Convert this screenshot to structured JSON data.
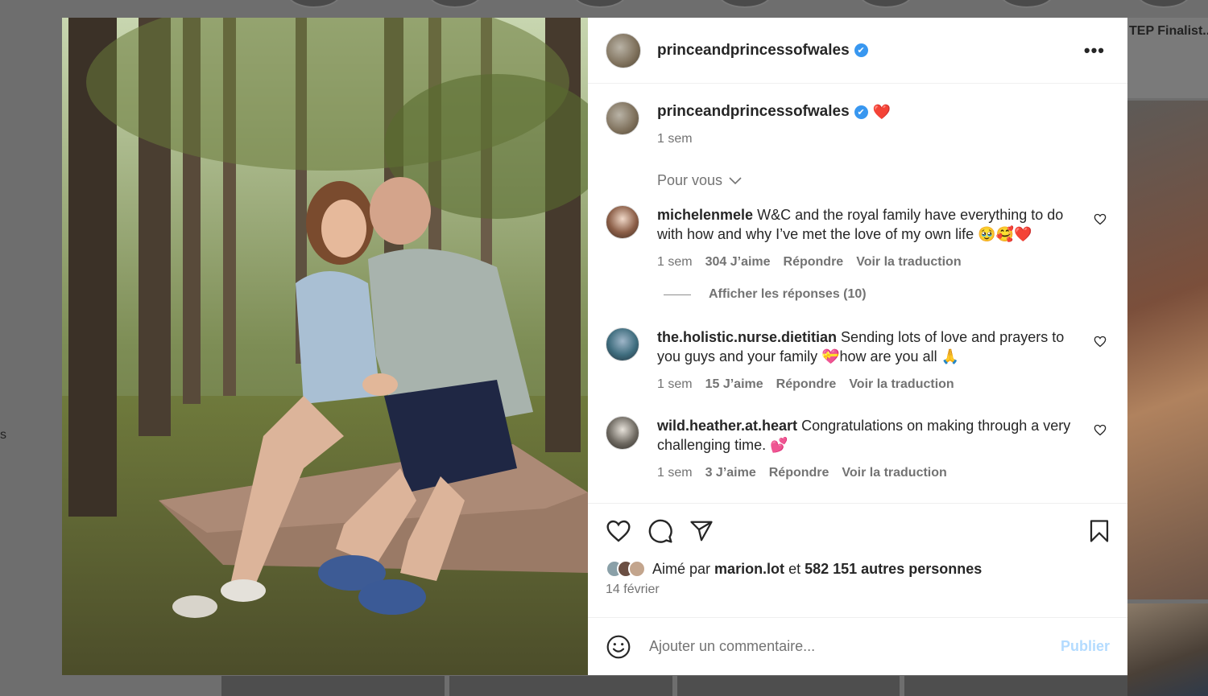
{
  "post": {
    "username": "princeandprincessofwales",
    "verified_mark": "✔",
    "more_label": "•••"
  },
  "caption": {
    "username": "princeandprincessofwales",
    "emoji": "❤️",
    "time": "1 sem"
  },
  "filter": {
    "label": "Pour vous"
  },
  "comments": [
    {
      "username": "michelenmele",
      "text": "W&C and the royal family have everything to do with how and why I’ve met the love of my own life 🥹🥰❤️",
      "time": "1 sem",
      "likes": "304 J’aime",
      "reply": "Répondre",
      "translate": "Voir la traduction",
      "replies_label": "Afficher les réponses (10)"
    },
    {
      "username": "the.holistic.nurse.dietitian",
      "text": "Sending lots of love and prayers to you guys and your family 💝how are you all 🙏",
      "time": "1 sem",
      "likes": "15 J’aime",
      "reply": "Répondre",
      "translate": "Voir la traduction"
    },
    {
      "username": "wild.heather.at.heart",
      "text": "Congratulations on making through a very challenging time. 💕",
      "time": "1 sem",
      "likes": "3 J’aime",
      "reply": "Répondre",
      "translate": "Voir la traduction"
    }
  ],
  "likes": {
    "prefix": "Aimé par",
    "first_user": "marion.lot",
    "joiner": "et",
    "others": "582 151 autres personnes"
  },
  "date": "14 février",
  "add_comment": {
    "placeholder": "Ajouter un commentaire...",
    "publish": "Publier"
  },
  "background": {
    "right_label": "TEP Finalist...",
    "left_mark": "s"
  },
  "colors": {
    "verified": "#3897f0",
    "publish_disabled": "#b3dbff",
    "muted": "#737373"
  },
  "icons": [
    "like-icon",
    "comment-icon",
    "share-icon",
    "bookmark-icon",
    "emoji-icon",
    "chevron-down-icon",
    "small-heart-icon"
  ]
}
